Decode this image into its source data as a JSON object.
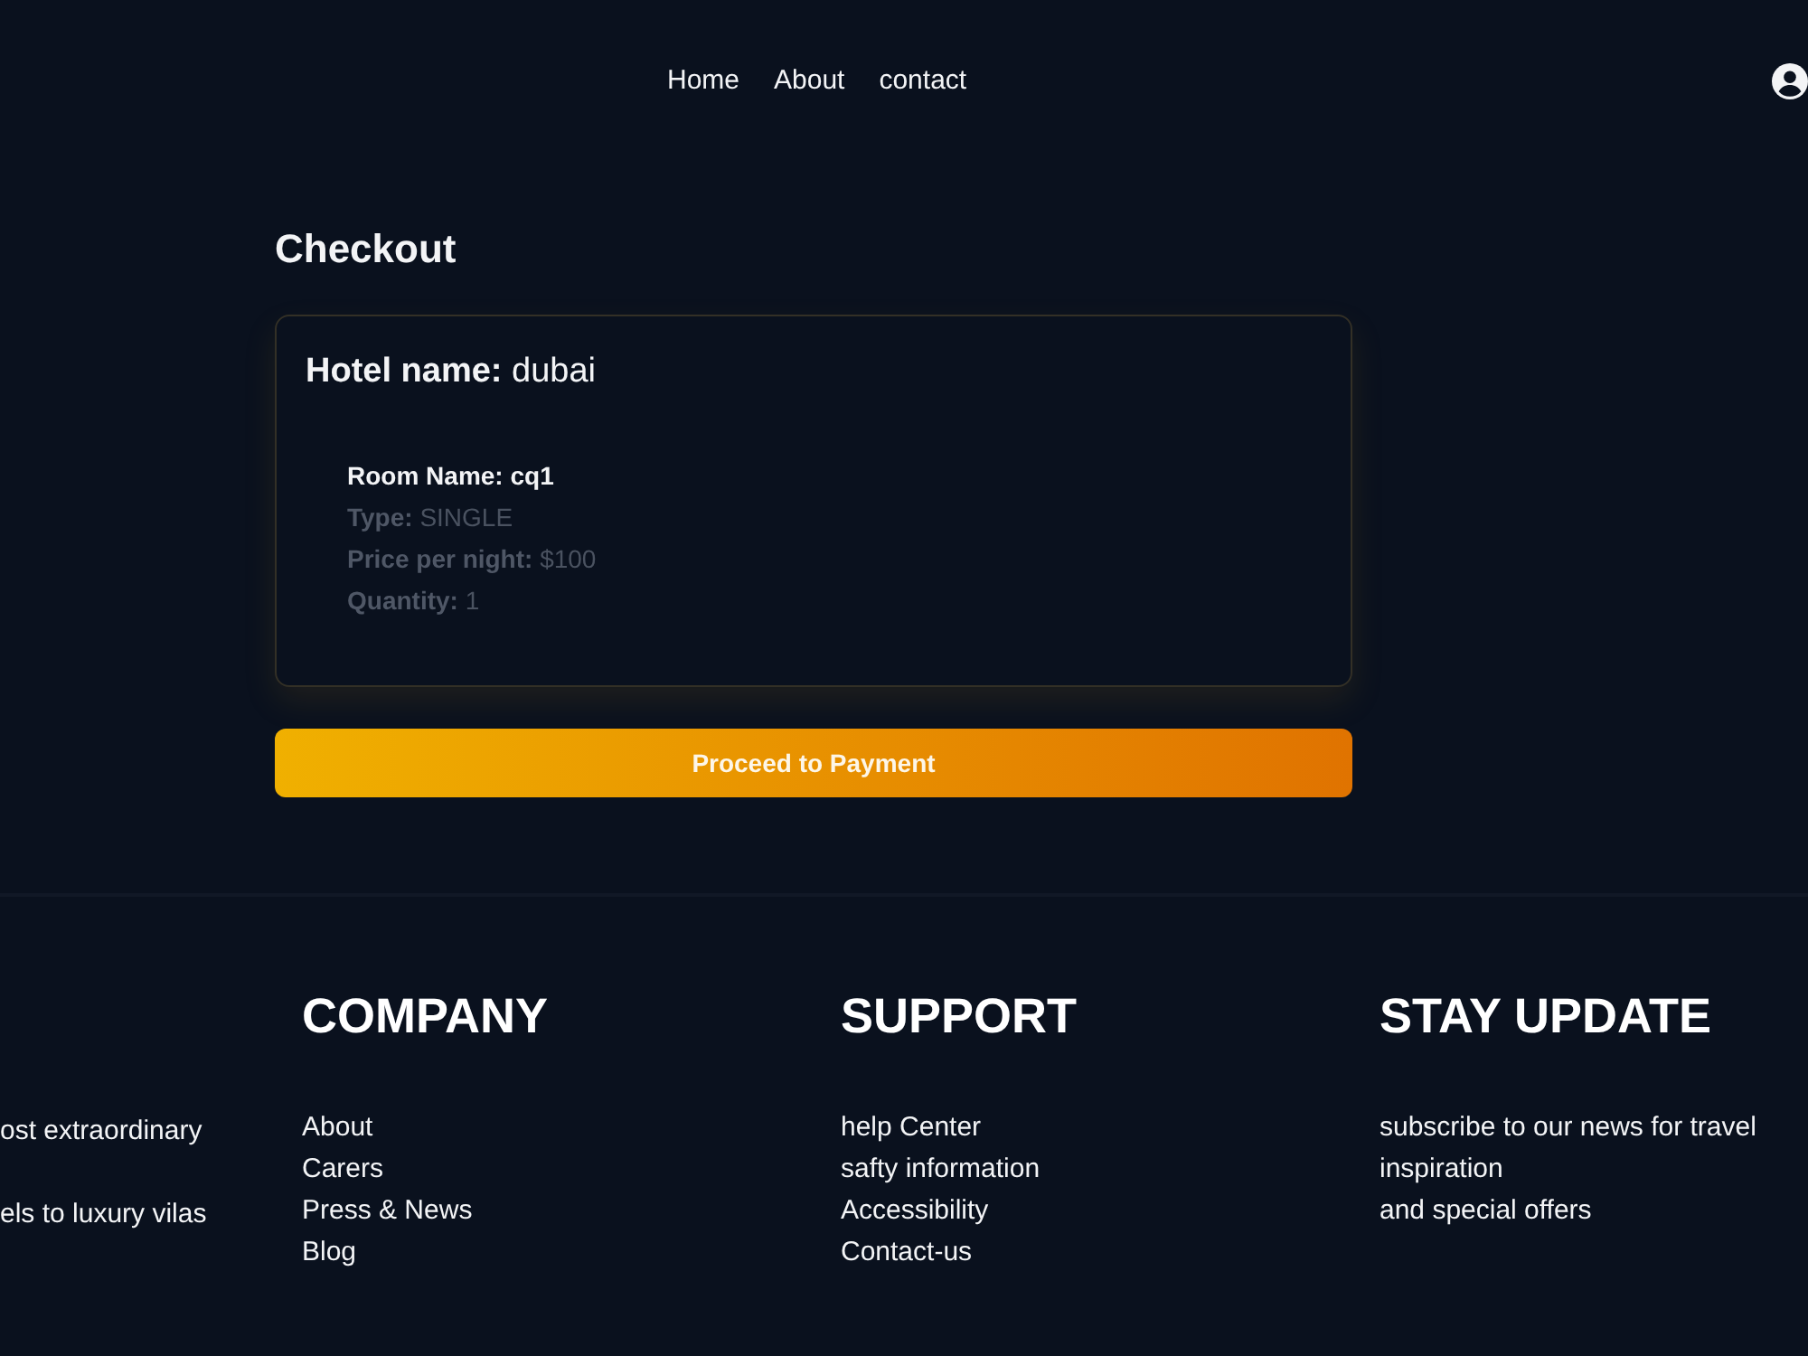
{
  "nav": {
    "links": [
      "Home",
      "About",
      "contact"
    ]
  },
  "checkout": {
    "title": "Checkout",
    "hotel": {
      "label": "Hotel name:",
      "value": "dubai"
    },
    "rooms": [
      {
        "fields": [
          {
            "kind": "name",
            "label": "Room Name:",
            "value": "cq1"
          },
          {
            "kind": "detail",
            "label": "Type:",
            "value": "SINGLE"
          },
          {
            "kind": "detail",
            "label": "Price per night:",
            "value": "$100"
          },
          {
            "kind": "detail",
            "label": "Quantity:",
            "value": "1"
          }
        ]
      }
    ],
    "button": "Proceed to Payment"
  },
  "footer": {
    "columns": [
      {
        "kind": "cut",
        "lines": [
          "ost extraordinary",
          "els to luxury vilas"
        ]
      },
      {
        "kind": "links",
        "heading": "COMPANY",
        "items": [
          "About",
          "Carers",
          "Press & News",
          "Blog"
        ]
      },
      {
        "kind": "links",
        "heading": "SUPPORT",
        "items": [
          "help Center",
          "safty information",
          "Accessibility",
          "Contact-us"
        ]
      },
      {
        "kind": "text",
        "heading": "STAY UPDATE",
        "paragraphs": [
          "subscribe to our news for travel inspiration",
          "and special offers"
        ]
      }
    ]
  }
}
